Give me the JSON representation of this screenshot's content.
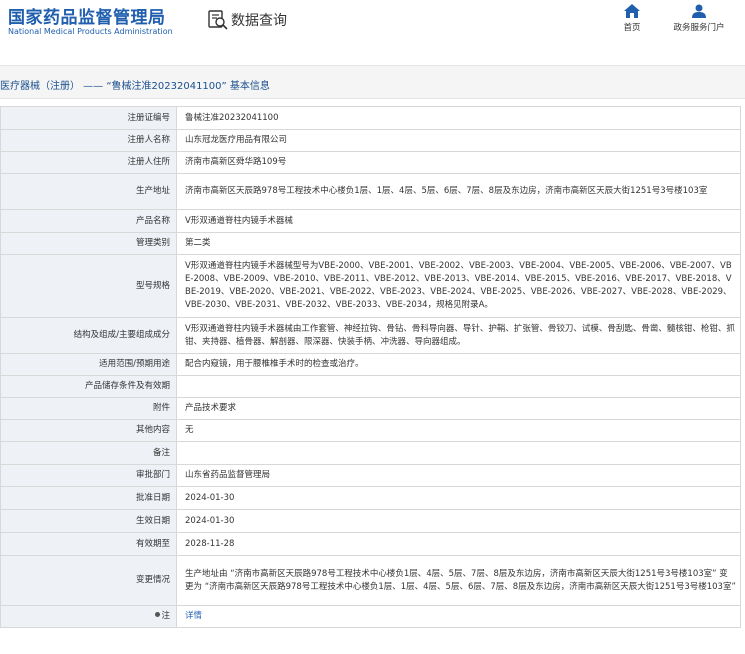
{
  "header": {
    "logo_cn": "国家药品监督管理局",
    "logo_en": "National Medical Products Administration",
    "data_query": "数据查询",
    "nav_home": "首页",
    "nav_service": "政务服务门户"
  },
  "colors": {
    "brand": "#1f5fae",
    "label_bg": "#eef2f7",
    "link": "#2a64b6"
  },
  "title": "医疗器械（注册） —— “鲁械注准20232041100” 基本信息",
  "rows": [
    {
      "label": "注册证编号",
      "value": "鲁械注准20232041100"
    },
    {
      "label": "注册人名称",
      "value": "山东冠龙医疗用品有限公司"
    },
    {
      "label": "注册人住所",
      "value": "济南市高新区舜华路109号"
    },
    {
      "label": "生产地址",
      "value": "济南市高新区天辰路978号工程技术中心楼负1层、1层、4层、5层、6层、7层、8层及东边房，济南市高新区天辰大街1251号3号楼103室"
    },
    {
      "label": "产品名称",
      "value": "V形双通道脊柱内镜手术器械"
    },
    {
      "label": "管理类别",
      "value": "第二类"
    },
    {
      "label": "型号规格",
      "value": "V形双通道脊柱内镜手术器械型号为VBE-2000、VBE-2001、VBE-2002、VBE-2003、VBE-2004、VBE-2005、VBE-2006、VBE-2007、VBE-2008、VBE-2009、VBE-2010、VBE-2011、VBE-2012、VBE-2013、VBE-2014、VBE-2015、VBE-2016、VBE-2017、VBE-2018、VBE-2019、VBE-2020、VBE-2021、VBE-2022、VBE-2023、VBE-2024、VBE-2025、VBE-2026、VBE-2027、VBE-2028、VBE-2029、VBE-2030、VBE-2031、VBE-2032、VBE-2033、VBE-2034，规格见附录A。"
    },
    {
      "label": "结构及组成/主要组成成分",
      "value": "V形双通道脊柱内镜手术器械由工作套管、神经拉钩、骨钻、骨科导向器、导针、护鞘、扩张管、骨铰刀、试模、骨刮匙、骨凿、髓核钳、枪钳、抓钳、夹持器、植骨器、解剖器、限深器、快装手柄、冲洗器、导向器组成。"
    },
    {
      "label": "适用范围/预期用途",
      "value": "配合内窥镜，用于腰椎椎手术时的检查或治疗。"
    },
    {
      "label": "产品储存条件及有效期",
      "value": ""
    },
    {
      "label": "附件",
      "value": "产品技术要求"
    },
    {
      "label": "其他内容",
      "value": "无"
    },
    {
      "label": "备注",
      "value": ""
    },
    {
      "label": "审批部门",
      "value": "山东省药品监督管理局"
    },
    {
      "label": "批准日期",
      "value": "2024-01-30"
    },
    {
      "label": "生效日期",
      "value": "2024-01-30"
    },
    {
      "label": "有效期至",
      "value": "2028-11-28"
    },
    {
      "label": "变更情况",
      "value": "生产地址由 “济南市高新区天辰路978号工程技术中心楼负1层、4层、5层、7层、8层及东边房，济南市高新区天辰大街1251号3号楼103室” 变更为 “济南市高新区天辰路978号工程技术中心楼负1层、1层、4层、5层、6层、7层、8层及东边房，济南市高新区天辰大街1251号3号楼103室”"
    }
  ],
  "note": {
    "label": "注",
    "link": "详情"
  }
}
